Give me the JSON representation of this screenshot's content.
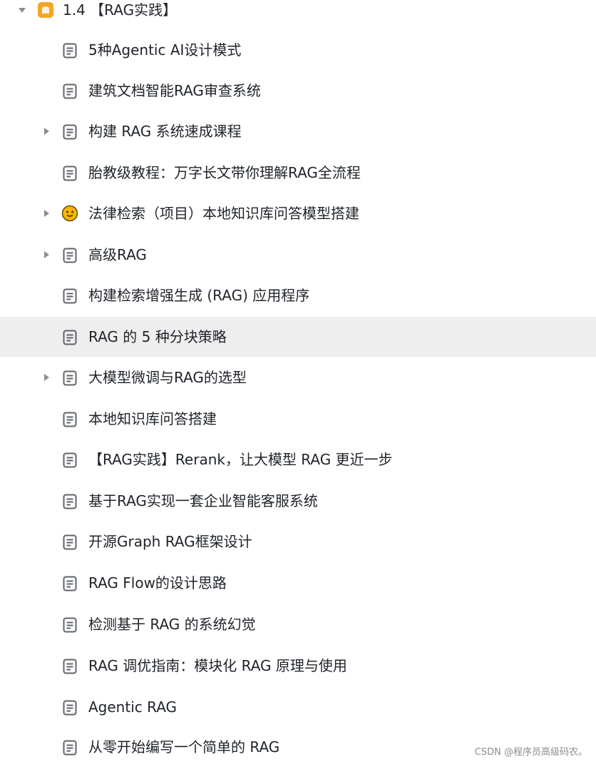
{
  "section": {
    "title": "1.4 【RAG实践】",
    "expanded": true,
    "icon": "folder-icon"
  },
  "items": [
    {
      "label": "5种Agentic AI设计模式",
      "icon": "doc-icon",
      "has_children": false
    },
    {
      "label": "建筑文档智能RAG审查系统",
      "icon": "doc-icon",
      "has_children": false
    },
    {
      "label": "构建 RAG 系统速成课程",
      "icon": "doc-icon",
      "has_children": true
    },
    {
      "label": "胎教级教程：万字长文带你理解RAG全流程",
      "icon": "doc-icon",
      "has_children": false
    },
    {
      "label": "法律检索（项目）本地知识库问答模型搭建",
      "icon": "smiley-icon",
      "has_children": true
    },
    {
      "label": "高级RAG",
      "icon": "doc-icon",
      "has_children": true
    },
    {
      "label": "构建检索增强生成 (RAG) 应用程序",
      "icon": "doc-icon",
      "has_children": false
    },
    {
      "label": "RAG 的 5 种分块策略",
      "icon": "doc-icon",
      "has_children": false,
      "highlighted": true
    },
    {
      "label": "大模型微调与RAG的选型",
      "icon": "doc-icon",
      "has_children": true
    },
    {
      "label": "本地知识库问答搭建",
      "icon": "doc-icon",
      "has_children": false
    },
    {
      "label": "【RAG实践】Rerank，让大模型 RAG 更近一步",
      "icon": "doc-icon",
      "has_children": false
    },
    {
      "label": "基于RAG实现一套企业智能客服系统",
      "icon": "doc-icon",
      "has_children": false
    },
    {
      "label": "开源Graph RAG框架设计",
      "icon": "doc-icon",
      "has_children": false
    },
    {
      "label": "RAG Flow的设计思路",
      "icon": "doc-icon",
      "has_children": false
    },
    {
      "label": "检测基于 RAG 的系统幻觉",
      "icon": "doc-icon",
      "has_children": false
    },
    {
      "label": "RAG 调优指南：模块化 RAG 原理与使用",
      "icon": "doc-icon",
      "has_children": false
    },
    {
      "label": "Agentic RAG",
      "icon": "doc-icon",
      "has_children": false
    },
    {
      "label": "从零开始编写一个简单的 RAG",
      "icon": "doc-icon",
      "has_children": false
    }
  ],
  "watermark": "",
  "credit": "CSDN @程序员高级码农。",
  "colors": {
    "text": "#1f2329",
    "icon": "#5f6368",
    "caret": "#8a8d93",
    "hover_row": "#eeeeee",
    "folder": "#f5a623",
    "smiley": "#f7b500"
  }
}
